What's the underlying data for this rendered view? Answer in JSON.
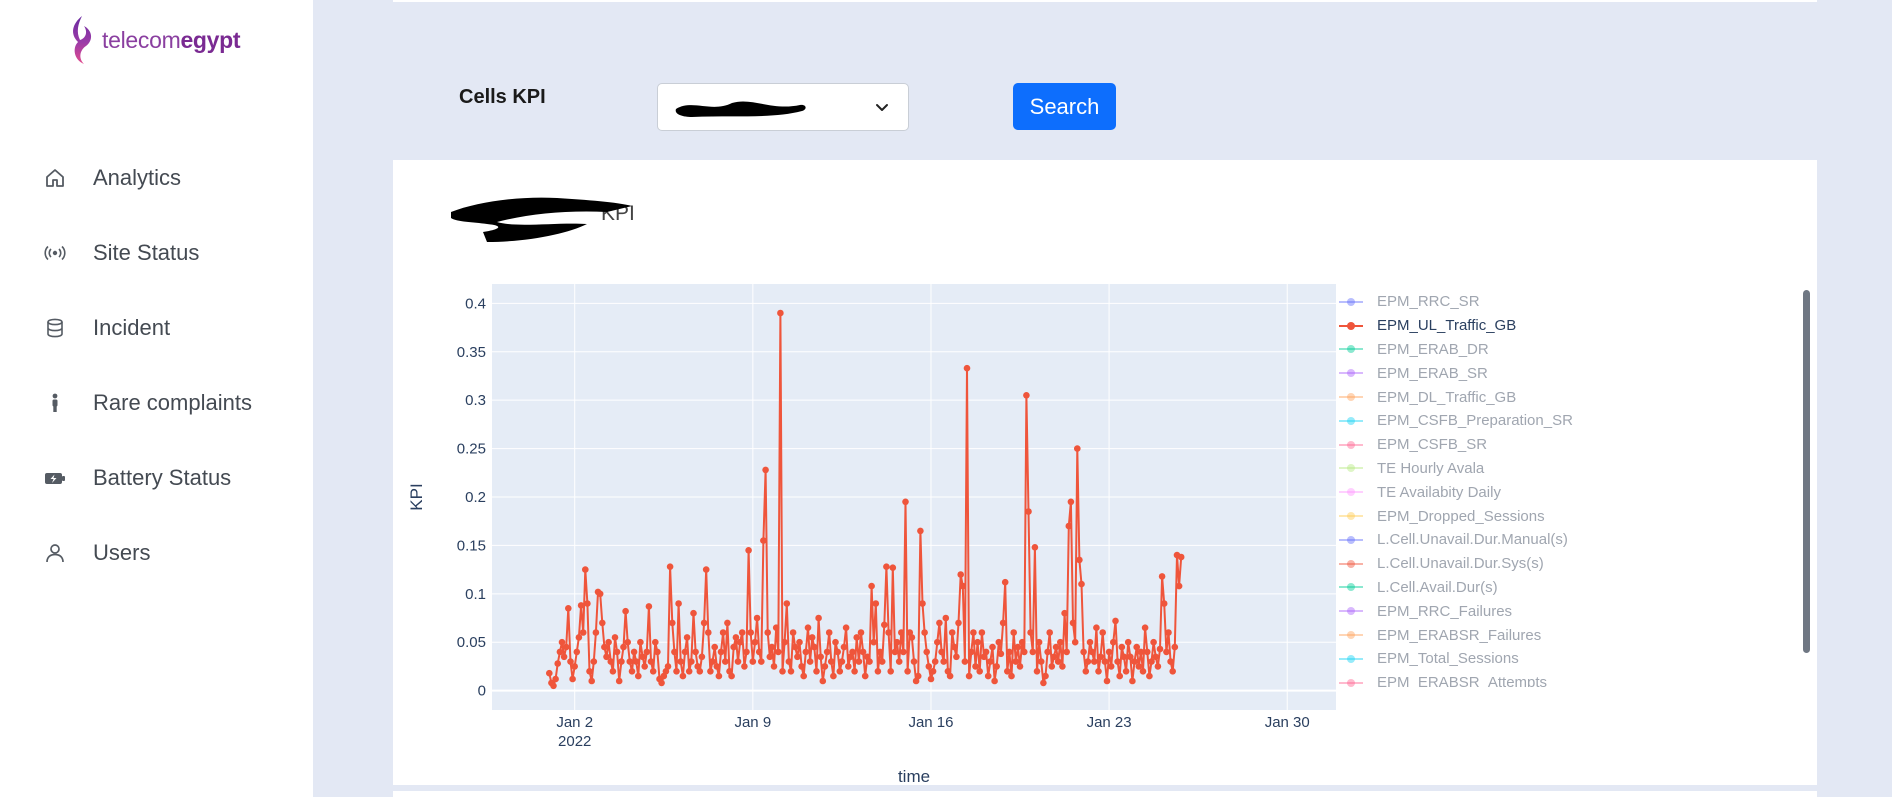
{
  "sidebar": {
    "logo_text_regular": "telecom",
    "logo_text_bold": "egypt",
    "items": [
      {
        "label": "Analytics",
        "icon": "home-icon"
      },
      {
        "label": "Site Status",
        "icon": "broadcast-icon"
      },
      {
        "label": "Incident",
        "icon": "database-icon"
      },
      {
        "label": "Rare complaints",
        "icon": "person-icon"
      },
      {
        "label": "Battery Status",
        "icon": "battery-charging-icon"
      },
      {
        "label": "Users",
        "icon": "user-icon"
      }
    ]
  },
  "filter": {
    "label": "Cells KPI",
    "search_label": "Search"
  },
  "chart": {
    "title_visible_suffix": "KPI",
    "accent": "#ef553b",
    "legend": [
      {
        "name": "EPM_RRC_SR",
        "color": "#636efa",
        "active": false
      },
      {
        "name": "EPM_UL_Traffic_GB",
        "color": "#ef553b",
        "active": true
      },
      {
        "name": "EPM_ERAB_DR",
        "color": "#00cc96",
        "active": false
      },
      {
        "name": "EPM_ERAB_SR",
        "color": "#ab63fa",
        "active": false
      },
      {
        "name": "EPM_DL_Traffic_GB",
        "color": "#ffa15a",
        "active": false
      },
      {
        "name": "EPM_CSFB_Preparation_SR",
        "color": "#19d3f3",
        "active": false
      },
      {
        "name": "EPM_CSFB_SR",
        "color": "#ff6692",
        "active": false
      },
      {
        "name": "TE Hourly Avala",
        "color": "#b6e880",
        "active": false
      },
      {
        "name": "TE Availabity Daily",
        "color": "#ff97ff",
        "active": false
      },
      {
        "name": "EPM_Dropped_Sessions",
        "color": "#fecb52",
        "active": false
      },
      {
        "name": "L.Cell.Unavail.Dur.Manual(s)",
        "color": "#636efa",
        "active": false
      },
      {
        "name": "L.Cell.Unavail.Dur.Sys(s)",
        "color": "#ef553b",
        "active": false
      },
      {
        "name": "L.Cell.Avail.Dur(s)",
        "color": "#00cc96",
        "active": false
      },
      {
        "name": "EPM_RRC_Failures",
        "color": "#ab63fa",
        "active": false
      },
      {
        "name": "EPM_ERABSR_Failures",
        "color": "#ffa15a",
        "active": false
      },
      {
        "name": "EPM_Total_Sessions",
        "color": "#19d3f3",
        "active": false
      },
      {
        "name": "EPM_ERABSR_Attempts",
        "color": "#ff6692",
        "active": false
      }
    ]
  },
  "chart_data": {
    "type": "line",
    "title": "",
    "xlabel": "time",
    "ylabel": "KPI",
    "ylim": [
      -0.02,
      0.42
    ],
    "xlim": [
      "2021-12-29T18:00",
      "2022-01-31T22:00"
    ],
    "x_ticks": [
      "Jan 2",
      "Jan 9",
      "Jan 16",
      "Jan 23",
      "Jan 30"
    ],
    "x_tick_sublabel": "2022",
    "y_ticks": [
      "0",
      "0.05",
      "0.1",
      "0.15",
      "0.2",
      "0.25",
      "0.3",
      "0.35",
      "0.4"
    ],
    "grid": true,
    "series": [
      {
        "name": "EPM_UL_Traffic_GB",
        "start": "2022-01-01T00:00",
        "step_hours": 2,
        "values": [
          0.018,
          0.008,
          0.005,
          0.012,
          0.028,
          0.04,
          0.05,
          0.035,
          0.045,
          0.085,
          0.03,
          0.012,
          0.025,
          0.04,
          0.055,
          0.088,
          0.06,
          0.125,
          0.09,
          0.02,
          0.01,
          0.03,
          0.06,
          0.102,
          0.1,
          0.07,
          0.045,
          0.035,
          0.05,
          0.03,
          0.02,
          0.055,
          0.04,
          0.01,
          0.03,
          0.045,
          0.082,
          0.05,
          0.03,
          0.02,
          0.04,
          0.03,
          0.015,
          0.05,
          0.035,
          0.025,
          0.04,
          0.087,
          0.03,
          0.02,
          0.05,
          0.04,
          0.012,
          0.008,
          0.015,
          0.02,
          0.025,
          0.128,
          0.07,
          0.04,
          0.02,
          0.09,
          0.03,
          0.015,
          0.04,
          0.055,
          0.02,
          0.03,
          0.08,
          0.04,
          0.025,
          0.02,
          0.035,
          0.07,
          0.125,
          0.06,
          0.02,
          0.03,
          0.045,
          0.025,
          0.015,
          0.04,
          0.06,
          0.03,
          0.07,
          0.02,
          0.015,
          0.045,
          0.055,
          0.03,
          0.05,
          0.06,
          0.025,
          0.04,
          0.145,
          0.06,
          0.03,
          0.05,
          0.075,
          0.04,
          0.03,
          0.155,
          0.228,
          0.06,
          0.035,
          0.045,
          0.025,
          0.065,
          0.04,
          0.39,
          0.02,
          0.05,
          0.09,
          0.03,
          0.02,
          0.06,
          0.045,
          0.035,
          0.05,
          0.025,
          0.015,
          0.04,
          0.065,
          0.03,
          0.055,
          0.045,
          0.02,
          0.075,
          0.035,
          0.01,
          0.025,
          0.04,
          0.06,
          0.03,
          0.015,
          0.05,
          0.04,
          0.02,
          0.03,
          0.045,
          0.065,
          0.025,
          0.035,
          0.04,
          0.02,
          0.055,
          0.03,
          0.06,
          0.04,
          0.015,
          0.035,
          0.03,
          0.108,
          0.05,
          0.09,
          0.02,
          0.04,
          0.03,
          0.068,
          0.128,
          0.06,
          0.02,
          0.127,
          0.04,
          0.05,
          0.03,
          0.06,
          0.04,
          0.195,
          0.02,
          0.06,
          0.055,
          0.03,
          0.01,
          0.015,
          0.165,
          0.09,
          0.06,
          0.04,
          0.025,
          0.012,
          0.02,
          0.03,
          0.05,
          0.07,
          0.04,
          0.03,
          0.075,
          0.02,
          0.015,
          0.06,
          0.045,
          0.035,
          0.07,
          0.12,
          0.108,
          0.03,
          0.333,
          0.015,
          0.04,
          0.06,
          0.025,
          0.05,
          0.02,
          0.06,
          0.035,
          0.04,
          0.015,
          0.03,
          0.045,
          0.01,
          0.025,
          0.05,
          0.038,
          0.07,
          0.112,
          0.02,
          0.04,
          0.015,
          0.06,
          0.03,
          0.045,
          0.025,
          0.05,
          0.04,
          0.305,
          0.185,
          0.06,
          0.04,
          0.148,
          0.02,
          0.05,
          0.03,
          0.008,
          0.015,
          0.04,
          0.06,
          0.025,
          0.035,
          0.045,
          0.03,
          0.05,
          0.025,
          0.08,
          0.04,
          0.17,
          0.195,
          0.07,
          0.05,
          0.25,
          0.135,
          0.11,
          0.04,
          0.02,
          0.03,
          0.05,
          0.04,
          0.03,
          0.065,
          0.02,
          0.035,
          0.06,
          0.03,
          0.01,
          0.04,
          0.025,
          0.05,
          0.072,
          0.03,
          0.015,
          0.045,
          0.035,
          0.02,
          0.05,
          0.035,
          0.01,
          0.03,
          0.045,
          0.025,
          0.04,
          0.02,
          0.065,
          0.04,
          0.015,
          0.03,
          0.05,
          0.035,
          0.025,
          0.043,
          0.118,
          0.09,
          0.04,
          0.06,
          0.03,
          0.02,
          0.045,
          0.14,
          0.108,
          0.138
        ]
      }
    ]
  }
}
